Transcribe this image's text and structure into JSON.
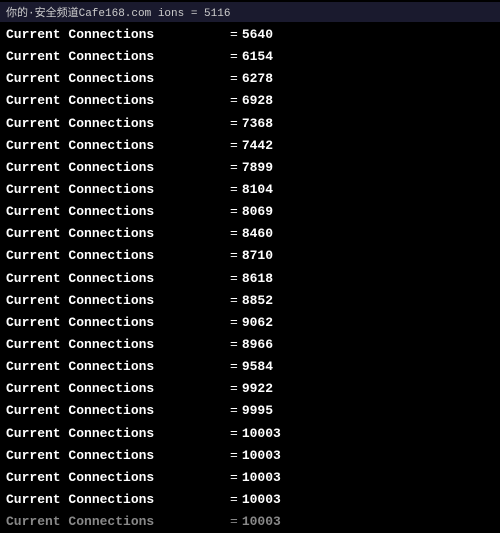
{
  "header": {
    "text": "你的·安全频道Cafe168.com    ions                            = 5116"
  },
  "rows": [
    {
      "label": "Current  Connections",
      "value": "5640"
    },
    {
      "label": "Current  Connections",
      "value": "6154"
    },
    {
      "label": "Current  Connections",
      "value": "6278"
    },
    {
      "label": "Current  Connections",
      "value": "6928"
    },
    {
      "label": "Current  Connections",
      "value": "7368"
    },
    {
      "label": "Current  Connections",
      "value": "7442"
    },
    {
      "label": "Current  Connections",
      "value": "7899"
    },
    {
      "label": "Current  Connections",
      "value": "8104"
    },
    {
      "label": "Current  Connections",
      "value": "8069"
    },
    {
      "label": "Current  Connections",
      "value": "8460"
    },
    {
      "label": "Current  Connections",
      "value": "8710"
    },
    {
      "label": "Current  Connections",
      "value": "8618"
    },
    {
      "label": "Current  Connections",
      "value": "8852"
    },
    {
      "label": "Current  Connections",
      "value": "9062"
    },
    {
      "label": "Current  Connections",
      "value": "8966"
    },
    {
      "label": "Current  Connections",
      "value": "9584"
    },
    {
      "label": "Current  Connections",
      "value": "9922"
    },
    {
      "label": "Current  Connections",
      "value": "9995"
    },
    {
      "label": "Current  Connections",
      "value": "10003"
    },
    {
      "label": "Current  Connections",
      "value": "10003"
    },
    {
      "label": "Current  Connections",
      "value": "10003"
    },
    {
      "label": "Current  Connections",
      "value": "10003"
    },
    {
      "label": "Current  Connections",
      "value": "10003",
      "partial": true
    }
  ],
  "equals_sign": "=",
  "colors": {
    "background": "#000000",
    "text": "#ffffff",
    "header_bg": "#1a1a2e",
    "header_text": "#cccccc"
  }
}
